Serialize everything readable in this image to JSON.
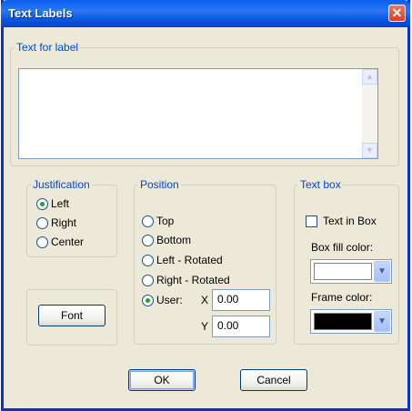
{
  "window": {
    "title": "Text Labels",
    "close_glyph": "✕"
  },
  "text_for_label": {
    "legend": "Text for label",
    "value": "",
    "scroll_up": "▲",
    "scroll_down": "▼"
  },
  "justification": {
    "legend": "Justification",
    "options": [
      "Left",
      "Right",
      "Center"
    ],
    "selected": "Left"
  },
  "position": {
    "legend": "Position",
    "options": [
      "Top",
      "Bottom",
      "Left - Rotated",
      "Right - Rotated",
      "User:"
    ],
    "selected": "User:",
    "x_label": "X",
    "x_value": "0.00",
    "y_label": "Y",
    "y_value": "0.00"
  },
  "text_box": {
    "legend": "Text box",
    "text_in_box_label": "Text in Box",
    "text_in_box_checked": false,
    "box_fill_label": "Box fill color:",
    "box_fill_color": "#ffffff",
    "frame_label": "Frame color:",
    "frame_color": "#000000",
    "dropdown_glyph": "▼"
  },
  "buttons": {
    "font": "Font",
    "ok": "OK",
    "cancel": "Cancel"
  }
}
